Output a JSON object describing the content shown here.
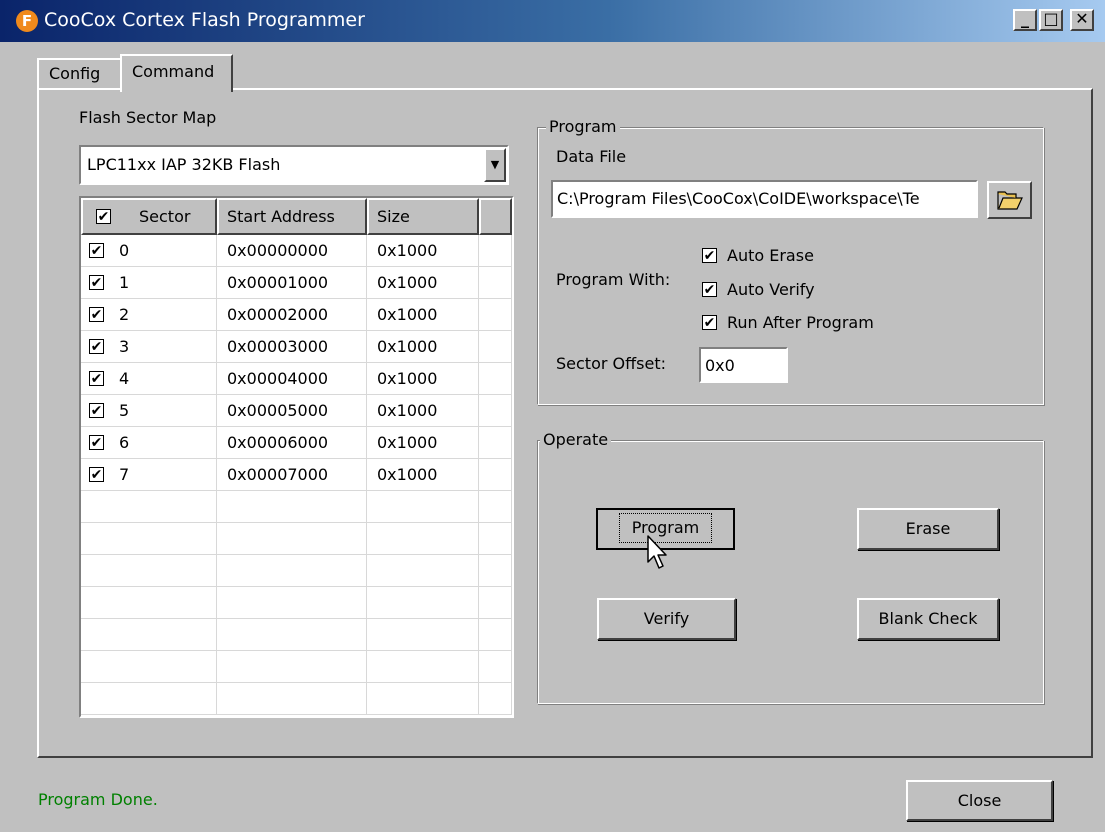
{
  "window": {
    "title": "CooCox Cortex Flash Programmer",
    "icon_letter": "F"
  },
  "caption_buttons": [
    "minimize-icon",
    "maximize-icon",
    "close-icon"
  ],
  "tabs": [
    {
      "label": "Config",
      "active": false
    },
    {
      "label": "Command",
      "active": true
    }
  ],
  "flash_map": {
    "label": "Flash Sector Map",
    "selected": "LPC11xx IAP 32KB Flash"
  },
  "grid": {
    "columns": [
      "Sector",
      "Start Address",
      "Size"
    ],
    "header_checked": true,
    "rows": [
      {
        "sector": "0",
        "start": "0x00000000",
        "size": "0x1000",
        "checked": true
      },
      {
        "sector": "1",
        "start": "0x00001000",
        "size": "0x1000",
        "checked": true
      },
      {
        "sector": "2",
        "start": "0x00002000",
        "size": "0x1000",
        "checked": true
      },
      {
        "sector": "3",
        "start": "0x00003000",
        "size": "0x1000",
        "checked": true
      },
      {
        "sector": "4",
        "start": "0x00004000",
        "size": "0x1000",
        "checked": true
      },
      {
        "sector": "5",
        "start": "0x00005000",
        "size": "0x1000",
        "checked": true
      },
      {
        "sector": "6",
        "start": "0x00006000",
        "size": "0x1000",
        "checked": true
      },
      {
        "sector": "7",
        "start": "0x00007000",
        "size": "0x1000",
        "checked": true
      }
    ]
  },
  "program_group": {
    "legend": "Program",
    "data_file_label": "Data File",
    "data_file_value": "C:\\Program Files\\CooCox\\CoIDE\\workspace\\Te",
    "program_with_label": "Program With:",
    "options": [
      {
        "label": "Auto Erase",
        "checked": true
      },
      {
        "label": "Auto Verify",
        "checked": true
      },
      {
        "label": "Run After Program",
        "checked": true
      }
    ],
    "sector_offset_label": "Sector Offset:",
    "sector_offset_value": "0x0"
  },
  "operate_group": {
    "legend": "Operate",
    "program_label": "Program",
    "erase_label": "Erase",
    "verify_label": "Verify",
    "blank_check_label": "Blank Check"
  },
  "status": {
    "text": "Program Done.",
    "color": "#008000"
  },
  "close_label": "Close"
}
